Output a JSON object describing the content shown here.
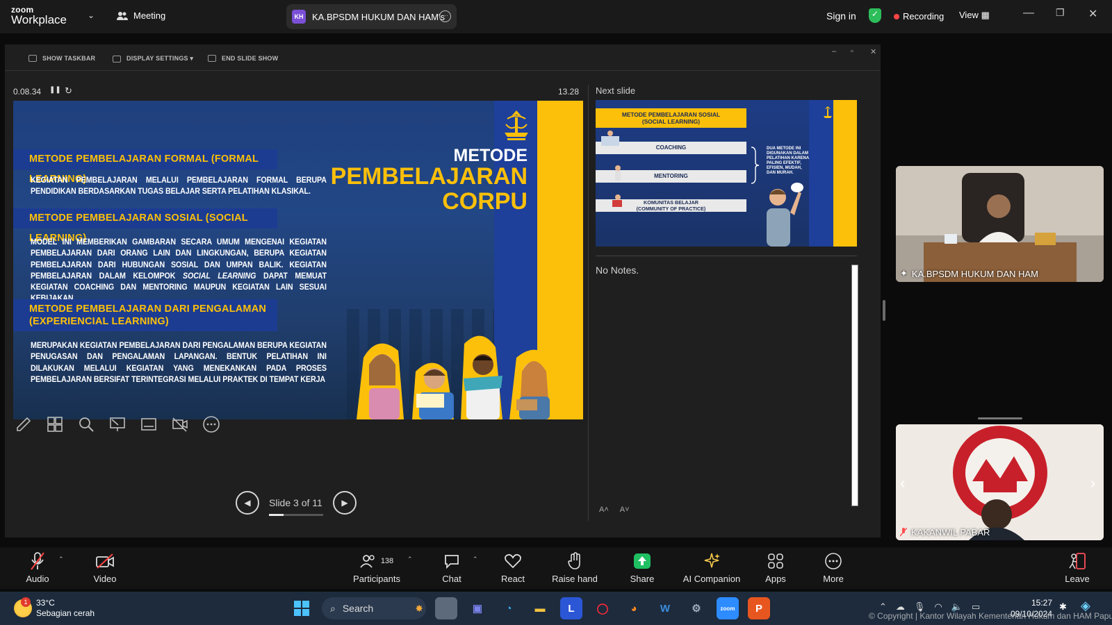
{
  "app": {
    "brand_top": "zoom",
    "brand_bottom": "Workplace",
    "meeting_label": "Meeting",
    "meeting_title": "KA.BPSDM HUKUM DAN HAM's",
    "initials": "KH",
    "sign_in": "Sign in",
    "recording": "Recording",
    "view": "View"
  },
  "slideshow": {
    "tools": {
      "show_taskbar": "SHOW TASKBAR",
      "display_settings": "DISPLAY SETTINGS ▾",
      "end_slide_show": "END SLIDE SHOW"
    },
    "elapsed": "0.08.34",
    "clock": "13.28",
    "next_slide_label": "Next slide",
    "notes": "No Notes.",
    "slide_counter": "Slide 3 of 11",
    "slide_current": 3,
    "slide_total": 11
  },
  "slide": {
    "sec1_title": "METODE PEMBELAJARAN FORMAL (FORMAL LEARNING)",
    "sec1_text": "KEGIATAN PEMBELAJARAN MELALUI PEMBELAJARAN FORMAL BERUPA PENDIDIKAN BERDASARKAN TUGAS BELAJAR SERTA PELATIHAN KLASIKAL.",
    "sec2_title": "METODE PEMBELAJARAN SOSIAL (SOCIAL LEARNING)",
    "sec2_text_a": "MODEL INI MEMBERIKAN GAMBARAN SECARA UMUM MENGENAI KEGIATAN PEMBELAJARAN DARI ORANG LAIN DAN LINGKUNGAN, BERUPA KEGIATAN PEMBELAJARAN DARI HUBUNGAN SOSIAL DAN UMPAN BALIK. KEGIATAN PEMBELAJARAN DALAM KELOMPOK ",
    "sec2_text_italic": "SOCIAL LEARNING",
    "sec2_text_b": " DAPAT MEMUAT KEGIATAN COACHING DAN MENTORING MAUPUN KEGIATAN LAIN SESUAI KEBIJAKAN.",
    "sec3_title_1": "METODE PEMBELAJARAN DARI PENGALAMAN",
    "sec3_title_2": "(EXPERIENCIAL LEARNING)",
    "sec3_text": "MERUPAKAN KEGIATAN PEMBELAJARAN DARI PENGALAMAN BERUPA KEGIATAN PENUGASAN DAN PENGALAMAN LAPANGAN. BENTUK PELATIHAN INI DILAKUKAN MELALUI KEGIATAN YANG MENEKANKAN PADA PROSES PEMBELAJARAN BERSIFAT TERINTEGRASI MELALUI PRAKTEK DI TEMPAT KERJA",
    "title_1": "METODE",
    "title_2": "PEMBELAJARAN",
    "title_3": "CORPU"
  },
  "next_slide": {
    "head_1": "METODE PEMBELAJARAN SOSIAL",
    "head_2": "(SOCIAL LEARNING)",
    "row1": "COACHING",
    "row2": "MENTORING",
    "row3_1": "KOMUNITAS BELAJAR",
    "row3_2": "(COMMUNITY OF PRACTICE)",
    "side": "DUA METODE INI DIGUNAKAN DALAM PELATIHAN KARENA PALING EFEKTIF, EFISIEN, MUDAH, DAN MURAH."
  },
  "participants": [
    {
      "name": "KA.BPSDM HUKUM DAN HAM"
    },
    {
      "name": "KAKANWIL PABAR"
    }
  ],
  "controls": {
    "audio": "Audio",
    "video": "Video",
    "participants": "Participants",
    "participants_count": "138",
    "chat": "Chat",
    "react": "React",
    "raise_hand": "Raise hand",
    "share": "Share",
    "ai_companion": "AI Companion",
    "apps": "Apps",
    "more": "More",
    "leave": "Leave"
  },
  "taskbar": {
    "temp": "33°C",
    "weather": "Sebagian cerah",
    "weather_badge": "1",
    "search": "Search",
    "time": "15:27",
    "date": "09/10/2024",
    "copyright": "© Copyright | Kantor Wilayah Kementerian Hukum dan HAM Papua Barat"
  },
  "colors": {
    "accent_yellow": "#fcc00a",
    "slide_blue": "#1c3c92",
    "share_green": "#1fbf62",
    "recording_red": "#ff4545"
  }
}
